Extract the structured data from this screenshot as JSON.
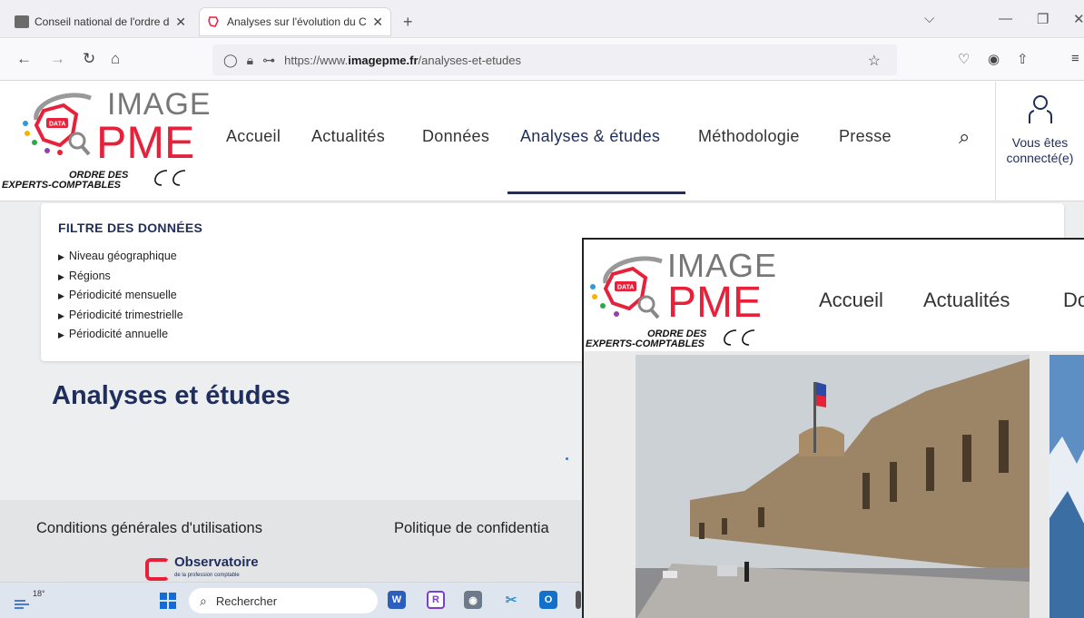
{
  "browser": {
    "tabs": [
      {
        "label": "Conseil national de l'ordre des e",
        "close": "✕",
        "active": false
      },
      {
        "label": "Analyses sur l'évolution du CA e",
        "close": "✕",
        "active": true
      }
    ],
    "new_tab": "+",
    "url_prefix": "https://www.",
    "url_domain": "imagepme.fr",
    "url_path": "/analyses-et-etudes"
  },
  "site": {
    "logo": {
      "image": "IMAGE",
      "pme": "PME",
      "data": "DATA",
      "oec_line1": "ORDRE DES",
      "oec_line2": "EXPERTS-COMPTABLES"
    },
    "nav": [
      "Accueil",
      "Actualités",
      "Données",
      "Analyses & études",
      "Méthodologie",
      "Presse"
    ],
    "nav_active_index": 3,
    "user_label_line1": "Vous êtes",
    "user_label_line2": "connecté(e)",
    "filter": {
      "title": "FILTRE DES DONNÉES",
      "items": [
        "Niveau géographique",
        "Régions",
        "Périodicité mensuelle",
        "Périodicité trimestrielle",
        "Périodicité annuelle"
      ]
    },
    "page_title": "Analyses et études",
    "footer": {
      "links": [
        "Conditions générales d'utilisations",
        "Politique de confidentia"
      ],
      "observatoire": "Observatoire",
      "observatoire_sub": "de la profession comptable"
    }
  },
  "taskbar": {
    "temperature": "18°",
    "search_placeholder": "Rechercher"
  },
  "overlay": {
    "logo": {
      "image": "IMAGE",
      "pme": "PME",
      "data": "DATA",
      "oec_line1": "ORDRE DES",
      "oec_line2": "EXPERTS-COMPTABLES"
    },
    "nav": [
      "Accueil",
      "Actualités",
      "Do"
    ]
  },
  "colors": {
    "brand_red": "#e8213a",
    "brand_navy": "#1f2e5c",
    "page_bg": "#edeeef"
  }
}
